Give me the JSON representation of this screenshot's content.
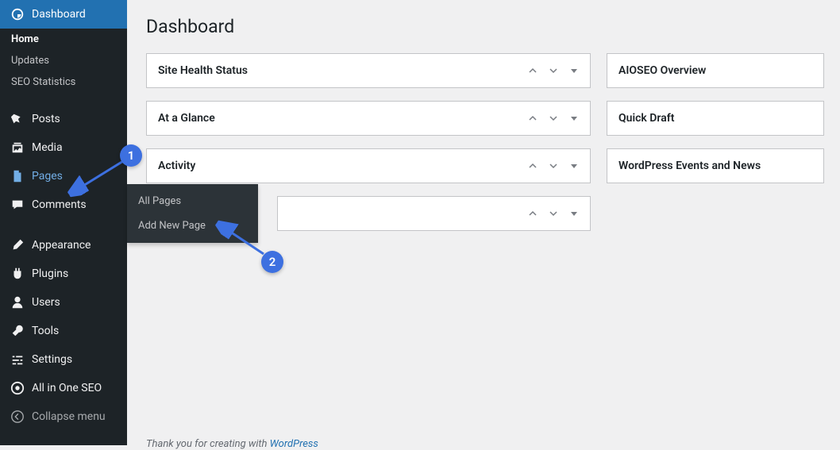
{
  "sidebar": {
    "dashboard": {
      "label": "Dashboard"
    },
    "sub": {
      "home": "Home",
      "updates": "Updates",
      "seo_stats": "SEO Statistics"
    },
    "posts": "Posts",
    "media": "Media",
    "pages": "Pages",
    "comments": "Comments",
    "appearance": "Appearance",
    "plugins": "Plugins",
    "users": "Users",
    "tools": "Tools",
    "settings": "Settings",
    "aioseo": "All in One SEO",
    "collapse": "Collapse menu"
  },
  "submenu": {
    "all_pages": "All Pages",
    "add_new": "Add New Page"
  },
  "page": {
    "title": "Dashboard"
  },
  "panels_left": {
    "site_health": "Site Health Status",
    "at_glance": "At a Glance",
    "activity": "Activity",
    "blank": ""
  },
  "panels_right": {
    "aioseo_overview": "AIOSEO Overview",
    "quick_draft": "Quick Draft",
    "wp_events": "WordPress Events and News"
  },
  "annotations": {
    "one": "1",
    "two": "2"
  },
  "footer": {
    "prefix": "Thank you for creating with ",
    "link": "WordPress"
  }
}
